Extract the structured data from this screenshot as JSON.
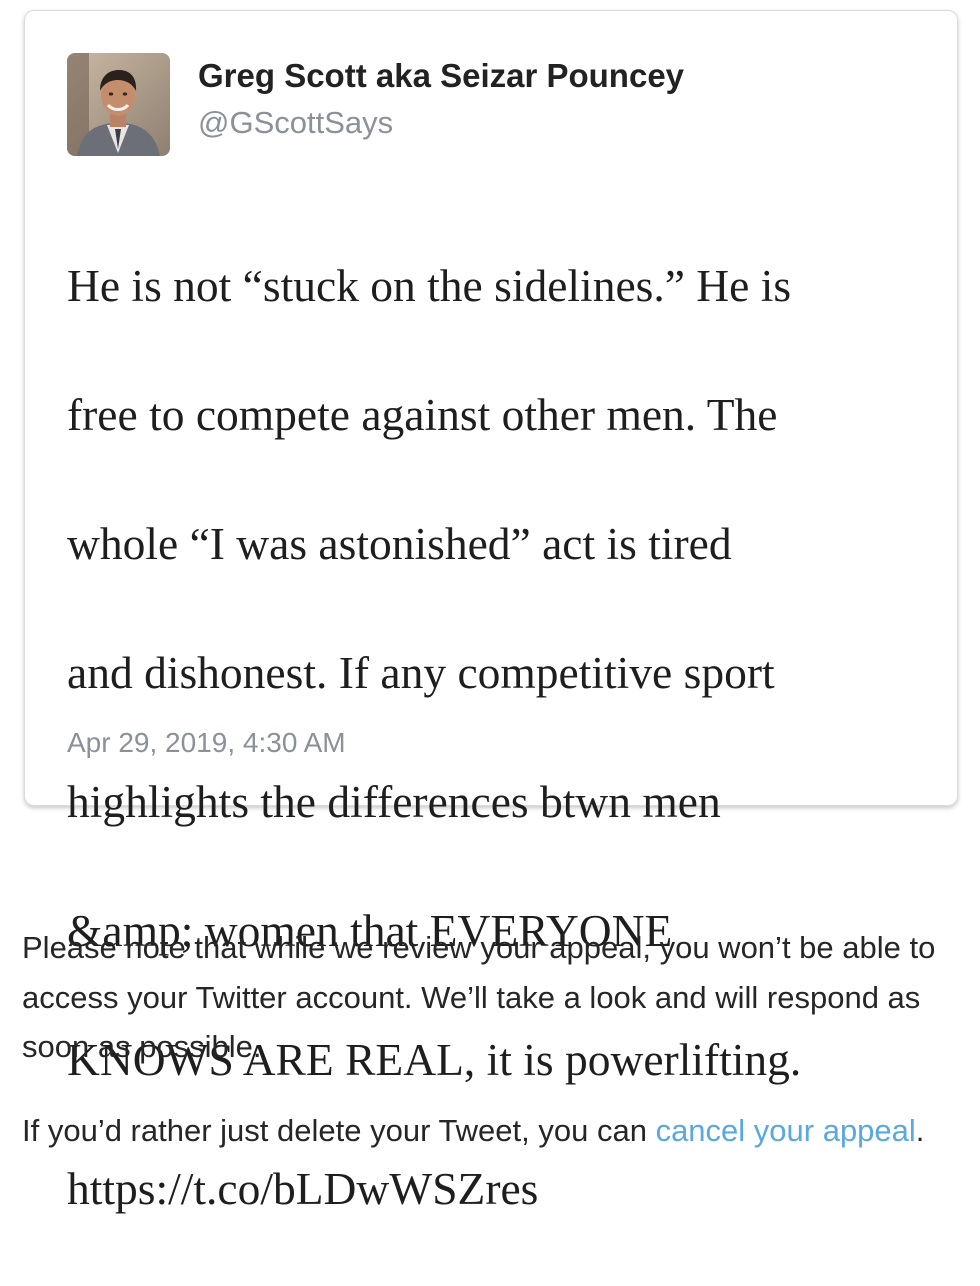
{
  "tweet": {
    "author_name": "Greg Scott aka Seizar Pouncey",
    "author_handle": "@GScottSays",
    "avatar_icon": "profile-photo",
    "text_lines": [
      "He is not “stuck on the sidelines.” He is",
      "free to compete against other men. The",
      "whole “I was astonished” act is tired",
      "and dishonest. If any competitive sport",
      "highlights the differences btwn men",
      "&amp; women that EVERYONE",
      "KNOWS ARE REAL, it is powerlifting.",
      "https://t.co/bLDwWSZres"
    ],
    "timestamp": "Apr 29, 2019, 4:30 AM"
  },
  "notice": {
    "text": "Please note that while we review your appeal, you won’t be able to access your Twitter account. We’ll take a look and will respond as soon as possible."
  },
  "cancel": {
    "prefix": "If you’d rather just delete your Tweet, you can ",
    "link_label": "cancel your appeal",
    "suffix": "."
  },
  "colors": {
    "link": "#5aa8e0",
    "secondary_text": "#8a9199",
    "card_border": "#dcdcdc"
  }
}
